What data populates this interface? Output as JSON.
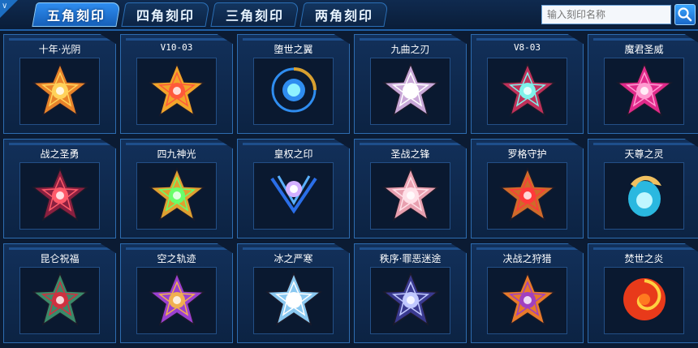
{
  "tabs": [
    {
      "label": "五角刻印",
      "active": true
    },
    {
      "label": "四角刻印",
      "active": false
    },
    {
      "label": "三角刻印",
      "active": false
    },
    {
      "label": "两角刻印",
      "active": false
    }
  ],
  "search": {
    "placeholder": "输入刻印名称"
  },
  "items": [
    {
      "name": "十年·光阴",
      "icon": "gold-flame-star-emblem",
      "color": "#e8832a",
      "accent": "#ffd25a"
    },
    {
      "name": "V10-03",
      "icon": "gold-red-star-emblem",
      "color": "#f2a52a",
      "accent": "#ff5a3a"
    },
    {
      "name": "堕世之翼",
      "icon": "blue-orb-ring-emblem",
      "color": "#2f8df0",
      "accent": "#8ff2ff"
    },
    {
      "name": "九曲之刃",
      "icon": "silver-blade-star-emblem",
      "color": "#c9a8d8",
      "accent": "#ffffff"
    },
    {
      "name": "V8-03",
      "icon": "red-teal-star-emblem",
      "color": "#c0305a",
      "accent": "#7ff2ea"
    },
    {
      "name": "魔君圣威",
      "icon": "magenta-star-emblem",
      "color": "#e02a8a",
      "accent": "#ff9ad0"
    },
    {
      "name": "战之圣勇",
      "icon": "crimson-crosshair-emblem",
      "color": "#8a2040",
      "accent": "#ff5a6a"
    },
    {
      "name": "四九神光",
      "icon": "gold-green-star-emblem",
      "color": "#e0a030",
      "accent": "#6aff6a"
    },
    {
      "name": "皇权之印",
      "icon": "blue-scepter-emblem",
      "color": "#2a6ee8",
      "accent": "#d2b0ff"
    },
    {
      "name": "圣战之锋",
      "icon": "pink-silver-star-emblem",
      "color": "#e8a0b0",
      "accent": "#ffe0e8"
    },
    {
      "name": "罗格守护",
      "icon": "copper-red-star-emblem",
      "color": "#d06a2a",
      "accent": "#ff3a3a"
    },
    {
      "name": "天尊之灵",
      "icon": "cyan-dragon-emblem",
      "color": "#2ab8e0",
      "accent": "#f0c060"
    },
    {
      "name": "昆仑祝福",
      "icon": "green-red-star-emblem",
      "color": "#3a8a6a",
      "accent": "#d03040"
    },
    {
      "name": "空之轨迹",
      "icon": "purple-gold-star-emblem",
      "color": "#9a40d0",
      "accent": "#f0b050"
    },
    {
      "name": "冰之严寒",
      "icon": "ice-star-emblem",
      "color": "#8ac8f0",
      "accent": "#ffffff"
    },
    {
      "name": "秩序·罪恶迷途",
      "icon": "dark-purple-star-emblem",
      "color": "#3a3a90",
      "accent": "#c0c8ff"
    },
    {
      "name": "决战之狩猎",
      "icon": "orange-spiked-star-emblem",
      "color": "#e87a2a",
      "accent": "#a040c0"
    },
    {
      "name": "焚世之炎",
      "icon": "fire-swirl-emblem",
      "color": "#e83a1a",
      "accent": "#ffd040"
    }
  ]
}
